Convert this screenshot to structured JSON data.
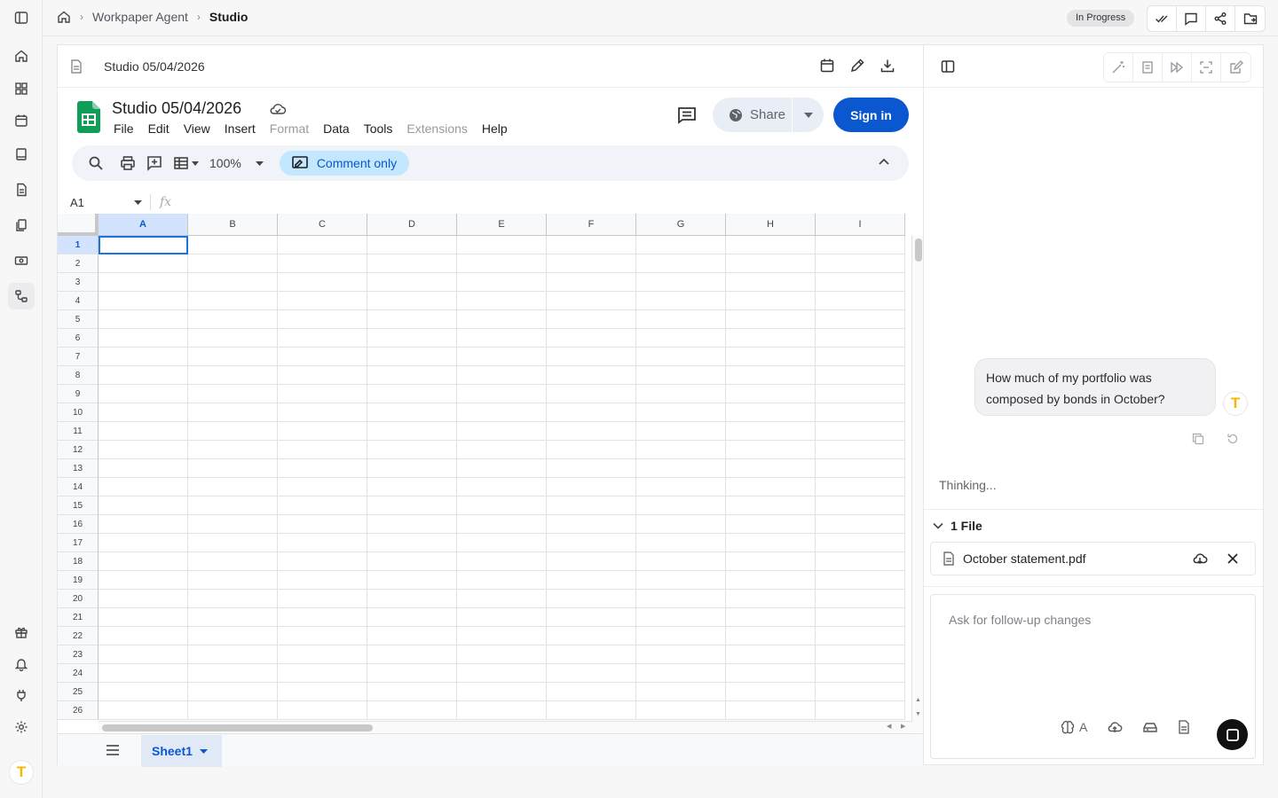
{
  "breadcrumb": {
    "section": "Workpaper Agent",
    "current": "Studio"
  },
  "status": "In Progress",
  "document": {
    "title": "Studio 05/04/2026"
  },
  "sheets": {
    "title": "Studio 05/04/2026",
    "menu": [
      {
        "label": "File",
        "disabled": false
      },
      {
        "label": "Edit",
        "disabled": false
      },
      {
        "label": "View",
        "disabled": false
      },
      {
        "label": "Insert",
        "disabled": false
      },
      {
        "label": "Format",
        "disabled": true
      },
      {
        "label": "Data",
        "disabled": false
      },
      {
        "label": "Tools",
        "disabled": false
      },
      {
        "label": "Extensions",
        "disabled": true
      },
      {
        "label": "Help",
        "disabled": false
      }
    ],
    "share_label": "Share",
    "signin_label": "Sign in",
    "zoom": "100%",
    "mode_label": "Comment only",
    "cell_ref": "A1",
    "columns": [
      "A",
      "B",
      "C",
      "D",
      "E",
      "F",
      "G",
      "H",
      "I"
    ],
    "rows": [
      "1",
      "2",
      "3",
      "4",
      "5",
      "6",
      "7",
      "8",
      "9",
      "10",
      "11",
      "12",
      "13",
      "14",
      "15",
      "16",
      "17",
      "18",
      "19",
      "20",
      "21",
      "22",
      "23",
      "24",
      "25",
      "26"
    ],
    "selected_cell": "A1",
    "sheet_tab": "Sheet1",
    "brand_green": "#0f9d58",
    "accent_blue": "#0b57d0"
  },
  "chat": {
    "user_message": "How much of my portfolio was composed by bonds in October?",
    "thinking": "Thinking...",
    "files_header": "1 File",
    "file_name": "October statement.pdf",
    "composer_placeholder": "Ask for follow-up changes",
    "model_label": "A"
  },
  "brand": {
    "avatar_letter": "T",
    "avatar_color": "#f5b800"
  },
  "icons": {
    "sidebar_top": [
      "sidebar-toggle-icon"
    ],
    "sidebar_nav": [
      "home-icon",
      "dashboard-icon",
      "calendar-icon",
      "book-icon",
      "document-icon",
      "files-icon",
      "money-icon",
      "workflow-icon"
    ],
    "sidebar_bottom": [
      "gift-icon",
      "bell-icon",
      "plug-icon",
      "settings-icon"
    ]
  }
}
